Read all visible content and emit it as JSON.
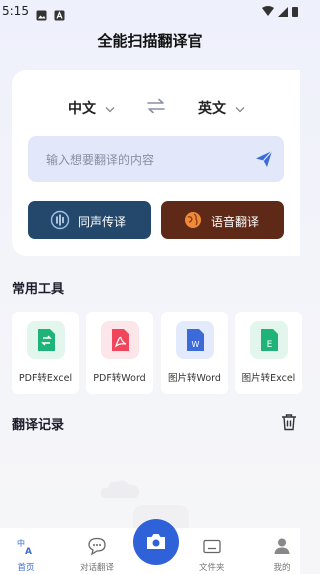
{
  "status_bar": {
    "time": "5:15"
  },
  "header": {
    "title": "全能扫描翻译官"
  },
  "translator": {
    "source_lang": "中文",
    "target_lang": "英文",
    "input_placeholder": "输入想要翻译的内容",
    "simultaneous_label": "同声传译",
    "voice_label": "语音翻译"
  },
  "tools_section": {
    "title": "常用工具",
    "items": [
      {
        "label": "PDF转Excel",
        "icon": "pdf-to-excel-icon",
        "color": "#1fb37a"
      },
      {
        "label": "PDF转Word",
        "icon": "pdf-to-word-icon",
        "color": "#f0455b"
      },
      {
        "label": "图片转Word",
        "icon": "image-to-word-icon",
        "color": "#3a6bd9"
      },
      {
        "label": "图片转Excel",
        "icon": "image-to-excel-icon",
        "color": "#1fb37a"
      }
    ]
  },
  "history_section": {
    "title": "翻译记录"
  },
  "bottom_nav": {
    "items": [
      {
        "label": "首页",
        "icon": "translate-icon"
      },
      {
        "label": "对话翻译",
        "icon": "chat-icon"
      },
      {
        "label": "文件夹",
        "icon": "folder-icon"
      },
      {
        "label": "我的",
        "icon": "profile-icon"
      }
    ]
  },
  "colors": {
    "accent": "#3a6bd9",
    "simultaneous_button": "#24486b",
    "voice_button": "#5e2a17",
    "input_bg": "#e3e7fa"
  }
}
